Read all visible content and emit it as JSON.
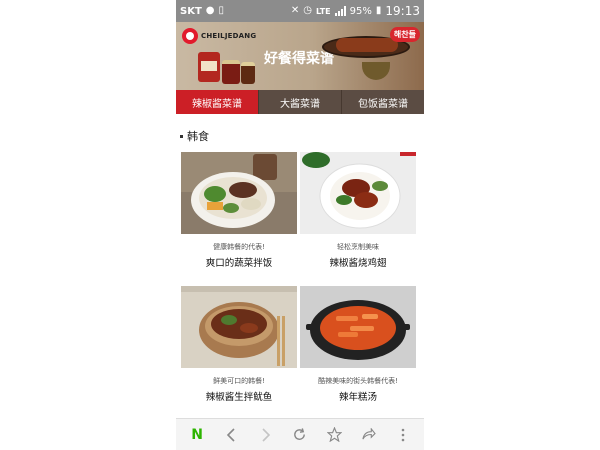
{
  "status_bar": {
    "carrier": "SKT",
    "network": "LTE",
    "battery": "95%",
    "time": "19:13"
  },
  "banner": {
    "brand": "CHEILJEDANG",
    "title": "好餐得菜谱",
    "badge": "해찬들"
  },
  "tabs": [
    {
      "label": "辣椒酱菜谱",
      "active": true
    },
    {
      "label": "大酱菜谱",
      "active": false
    },
    {
      "label": "包饭酱菜谱",
      "active": false
    }
  ],
  "section": {
    "title": "韩食"
  },
  "recipes": [
    {
      "subtitle": "健康韩餐的代表!",
      "title": "爽口的蔬菜拌饭"
    },
    {
      "subtitle": "轻松烹制美味",
      "title": "辣椒酱烧鸡翅"
    },
    {
      "subtitle": "鲜美可口的韩餐!",
      "title": "辣椒酱生拌鱿鱼"
    },
    {
      "subtitle": "酷辣美味的街头韩餐代表!",
      "title": "辣年糕汤"
    }
  ],
  "bottom_nav": {
    "home_label": "N",
    "icons": [
      "naver-home-icon",
      "back-icon",
      "forward-icon",
      "refresh-icon",
      "bookmark-star-icon",
      "share-icon",
      "more-icon"
    ]
  },
  "colors": {
    "accent": "#cc1f26",
    "tab_bar": "#5b4c43",
    "naver_green": "#2db400",
    "status_bar": "#8c8c8c"
  }
}
